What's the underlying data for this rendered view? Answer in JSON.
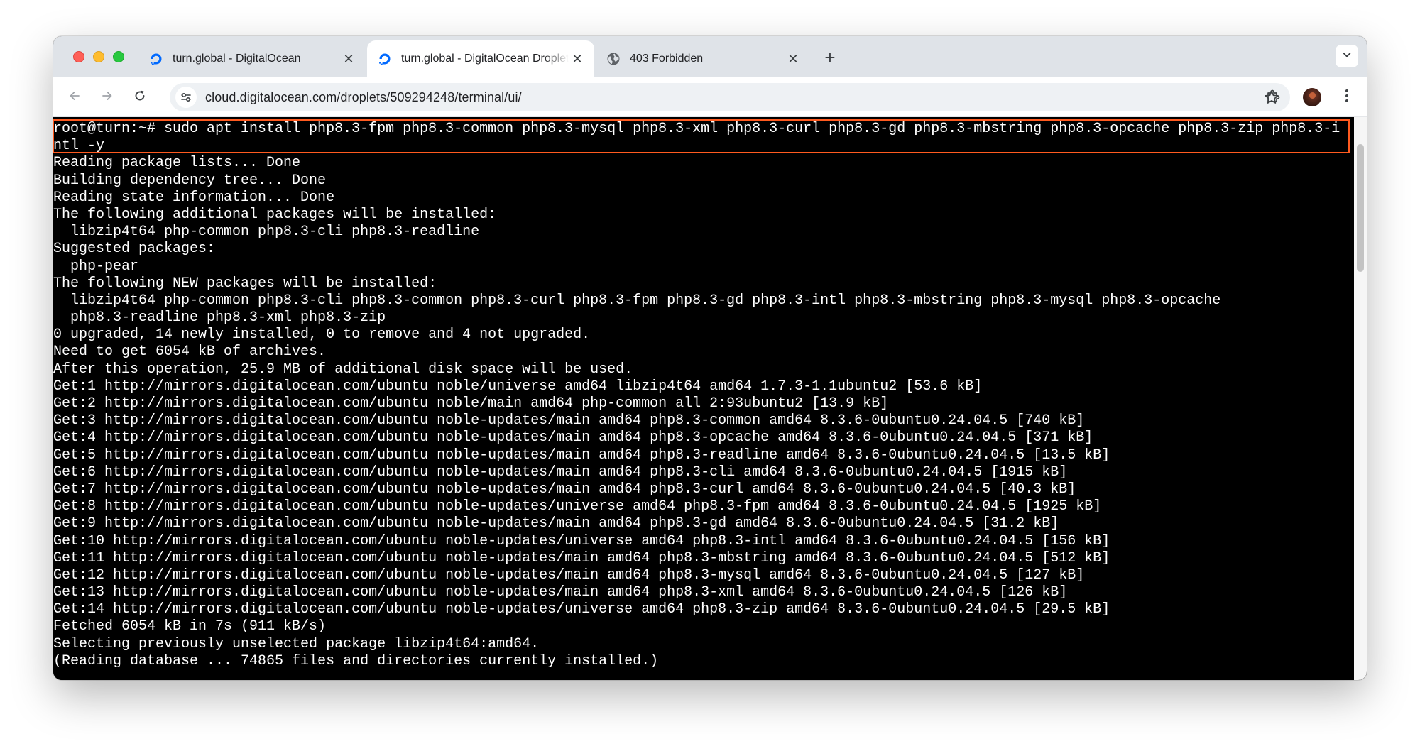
{
  "browser": {
    "tabs": [
      {
        "title": "turn.global - DigitalOcean",
        "favicon": "digitalocean-icon",
        "active": false
      },
      {
        "title": "turn.global - DigitalOcean Droplet",
        "favicon": "digitalocean-icon",
        "active": true
      },
      {
        "title": "403 Forbidden",
        "favicon": "globe-icon",
        "active": false
      }
    ],
    "close_glyph": "✕",
    "new_tab_glyph": "+",
    "url": "cloud.digitalocean.com/droplets/509294248/terminal/ui/",
    "brand_color": "#0069ff",
    "traffic_colors": {
      "close": "#fe5f57",
      "minimize": "#febc2e",
      "zoom": "#28c840"
    }
  },
  "terminal": {
    "highlight_color": "#ff5a1f",
    "lines": [
      "root@turn:~# sudo apt install php8.3-fpm php8.3-common php8.3-mysql php8.3-xml php8.3-curl php8.3-gd php8.3-mbstring php8.3-opcache php8.3-zip php8.3-i",
      "ntl -y",
      "Reading package lists... Done",
      "Building dependency tree... Done",
      "Reading state information... Done",
      "The following additional packages will be installed:",
      "  libzip4t64 php-common php8.3-cli php8.3-readline",
      "Suggested packages:",
      "  php-pear",
      "The following NEW packages will be installed:",
      "  libzip4t64 php-common php8.3-cli php8.3-common php8.3-curl php8.3-fpm php8.3-gd php8.3-intl php8.3-mbstring php8.3-mysql php8.3-opcache",
      "  php8.3-readline php8.3-xml php8.3-zip",
      "0 upgraded, 14 newly installed, 0 to remove and 4 not upgraded.",
      "Need to get 6054 kB of archives.",
      "After this operation, 25.9 MB of additional disk space will be used.",
      "Get:1 http://mirrors.digitalocean.com/ubuntu noble/universe amd64 libzip4t64 amd64 1.7.3-1.1ubuntu2 [53.6 kB]",
      "Get:2 http://mirrors.digitalocean.com/ubuntu noble/main amd64 php-common all 2:93ubuntu2 [13.9 kB]",
      "Get:3 http://mirrors.digitalocean.com/ubuntu noble-updates/main amd64 php8.3-common amd64 8.3.6-0ubuntu0.24.04.5 [740 kB]",
      "Get:4 http://mirrors.digitalocean.com/ubuntu noble-updates/main amd64 php8.3-opcache amd64 8.3.6-0ubuntu0.24.04.5 [371 kB]",
      "Get:5 http://mirrors.digitalocean.com/ubuntu noble-updates/main amd64 php8.3-readline amd64 8.3.6-0ubuntu0.24.04.5 [13.5 kB]",
      "Get:6 http://mirrors.digitalocean.com/ubuntu noble-updates/main amd64 php8.3-cli amd64 8.3.6-0ubuntu0.24.04.5 [1915 kB]",
      "Get:7 http://mirrors.digitalocean.com/ubuntu noble-updates/main amd64 php8.3-curl amd64 8.3.6-0ubuntu0.24.04.5 [40.3 kB]",
      "Get:8 http://mirrors.digitalocean.com/ubuntu noble-updates/universe amd64 php8.3-fpm amd64 8.3.6-0ubuntu0.24.04.5 [1925 kB]",
      "Get:9 http://mirrors.digitalocean.com/ubuntu noble-updates/main amd64 php8.3-gd amd64 8.3.6-0ubuntu0.24.04.5 [31.2 kB]",
      "Get:10 http://mirrors.digitalocean.com/ubuntu noble-updates/universe amd64 php8.3-intl amd64 8.3.6-0ubuntu0.24.04.5 [156 kB]",
      "Get:11 http://mirrors.digitalocean.com/ubuntu noble-updates/main amd64 php8.3-mbstring amd64 8.3.6-0ubuntu0.24.04.5 [512 kB]",
      "Get:12 http://mirrors.digitalocean.com/ubuntu noble-updates/main amd64 php8.3-mysql amd64 8.3.6-0ubuntu0.24.04.5 [127 kB]",
      "Get:13 http://mirrors.digitalocean.com/ubuntu noble-updates/main amd64 php8.3-xml amd64 8.3.6-0ubuntu0.24.04.5 [126 kB]",
      "Get:14 http://mirrors.digitalocean.com/ubuntu noble-updates/universe amd64 php8.3-zip amd64 8.3.6-0ubuntu0.24.04.5 [29.5 kB]",
      "Fetched 6054 kB in 7s (911 kB/s)",
      "Selecting previously unselected package libzip4t64:amd64.",
      "(Reading database ... 74865 files and directories currently installed.)"
    ]
  }
}
